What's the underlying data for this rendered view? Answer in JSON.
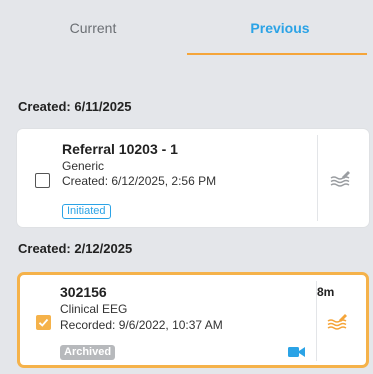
{
  "tabs": [
    {
      "label": "Current",
      "active": false
    },
    {
      "label": "Previous",
      "active": true
    }
  ],
  "colors": {
    "accent": "#f5a53a",
    "active_tab": "#2ba3e6",
    "badge_initiated": "#2ba3e6",
    "badge_archived": "#b7b9bc"
  },
  "groups": [
    {
      "header": "Created: 6/11/2025",
      "item": {
        "title": "Referral 10203 - 1",
        "type": "Generic",
        "detail": "Created: 6/12/2025, 2:56 PM",
        "status": "Initiated",
        "checked": false,
        "icon": "signal-waves-icon"
      }
    },
    {
      "header": "Created: 2/12/2025",
      "item": {
        "title": "302156",
        "duration": "8m",
        "type": "Clinical EEG",
        "detail": "Recorded: 9/6/2022, 10:37 AM",
        "status": "Archived",
        "checked": true,
        "icon": "signal-waves-edit-icon",
        "media_icon": "video-camera-icon"
      }
    }
  ]
}
